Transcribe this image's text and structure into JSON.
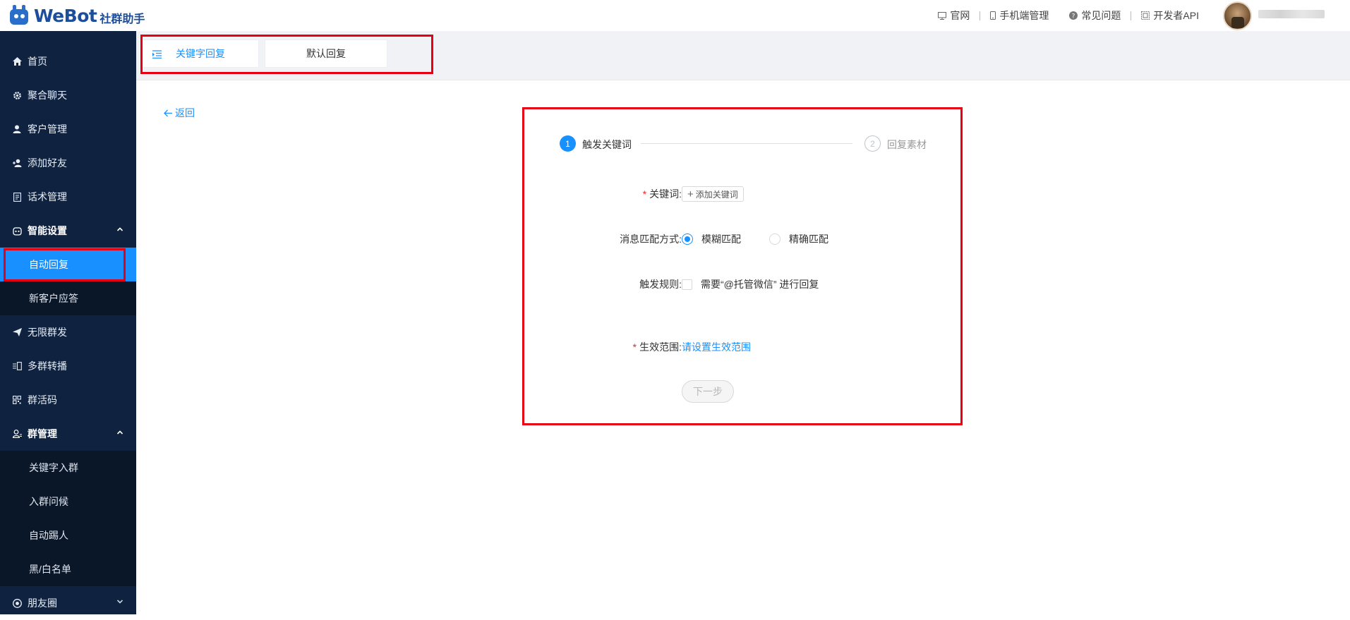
{
  "header": {
    "logo_text": "WeBot",
    "logo_sub": "社群助手",
    "nav": [
      {
        "label": "官网",
        "icon": "monitor-icon"
      },
      {
        "label": "手机端管理",
        "icon": "phone-icon"
      },
      {
        "label": "常见问题",
        "icon": "question-icon"
      },
      {
        "label": "开发者API",
        "icon": "api-icon"
      }
    ]
  },
  "sidebar": {
    "items": [
      {
        "label": "首页",
        "icon": "home-icon"
      },
      {
        "label": "聚合聊天",
        "icon": "gear-icon"
      },
      {
        "label": "客户管理",
        "icon": "user-icon"
      },
      {
        "label": "添加好友",
        "icon": "add-user-icon"
      },
      {
        "label": "话术管理",
        "icon": "document-icon"
      }
    ],
    "group_smart": {
      "label": "智能设置",
      "sub": [
        "自动回复",
        "新客户应答"
      ]
    },
    "items2": [
      {
        "label": "无限群发",
        "icon": "send-icon"
      },
      {
        "label": "多群转播",
        "icon": "broadcast-icon"
      },
      {
        "label": "群活码",
        "icon": "qrcode-icon"
      }
    ],
    "group_manage": {
      "label": "群管理",
      "sub": [
        "关键字入群",
        "入群问候",
        "自动踢人",
        "黑/白名单"
      ]
    },
    "moments": {
      "label": "朋友圈"
    }
  },
  "tabs": [
    {
      "label": "关键字回复",
      "active": true
    },
    {
      "label": "默认回复",
      "active": false
    }
  ],
  "main": {
    "back_label": "返回",
    "steps": [
      {
        "num": "1",
        "label": "触发关键词"
      },
      {
        "num": "2",
        "label": "回复素材"
      }
    ],
    "form": {
      "keyword_label": "关键词:",
      "add_keyword": "添加关键词",
      "match_label": "消息匹配方式:",
      "fuzzy": "模糊匹配",
      "exact": "精确匹配",
      "trigger_label": "触发规则:",
      "trigger_option": "需要“@托管微信” 进行回复",
      "scope_label": "生效范围:",
      "scope_link": "请设置生效范围",
      "next": "下一步"
    }
  },
  "colors": {
    "sidebar_bg": "#0f2341",
    "accent": "#1890ff",
    "highlight": "#e60012"
  }
}
